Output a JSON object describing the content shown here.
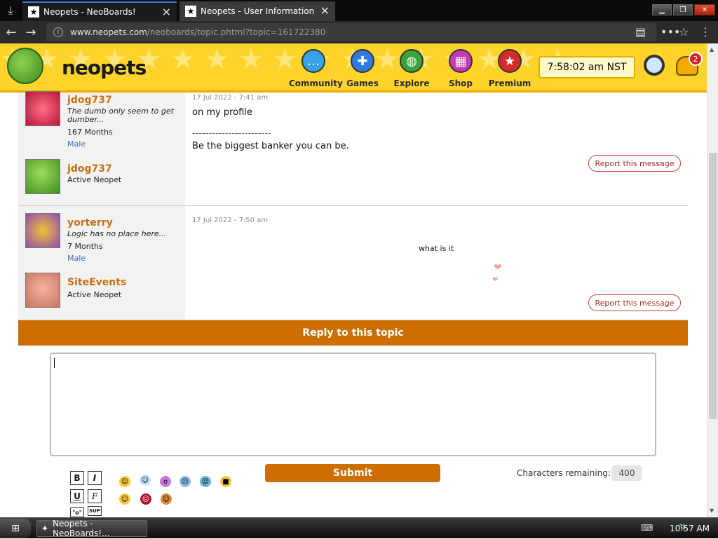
{
  "browser": {
    "tabs": [
      {
        "title": "Neopets - NeoBoards!",
        "active": true
      },
      {
        "title": "Neopets - User Information",
        "active": false
      }
    ],
    "url_host": "www.neopets.com",
    "url_path": "/neoboards/topic.phtml?topic=161722380"
  },
  "header": {
    "logo": "neopets",
    "nav": [
      {
        "label": "Community",
        "icon": "speech-bubble-icon",
        "color": "#3aa0e8"
      },
      {
        "label": "Games",
        "icon": "gamepad-icon",
        "color": "#2f7be0"
      },
      {
        "label": "Explore",
        "icon": "globe-icon",
        "color": "#3aa33a"
      },
      {
        "label": "Shop",
        "icon": "shopping-cart-icon",
        "color": "#c23ab7"
      },
      {
        "label": "Premium",
        "icon": "star-icon",
        "color": "#d62b2b"
      }
    ],
    "clock": "7:58:02 am NST",
    "notifications": "2"
  },
  "posts": [
    {
      "username": "jdog737",
      "signature": "The dumb only seem to get dumber...",
      "account_age": "167 Months",
      "gender": "Male",
      "pet_name": "jdog737",
      "pet_status": "Active Neopet",
      "date": "17 Jul 2022 - 7:41 am",
      "message_lines": [
        "on my profile",
        "------------------------",
        "Be the biggest banker you can be."
      ],
      "report": "Report this message"
    },
    {
      "username": "yorterry",
      "signature": "Logic has no place here...",
      "account_age": "7 Months",
      "gender": "Male",
      "pet_name": "SiteEvents",
      "pet_status": "Active Neopet",
      "date": "17 Jul 2022 - 7:50 am",
      "message_lines": [
        "what is it"
      ],
      "report": "Report this message"
    }
  ],
  "reply": {
    "title": "Reply to this topic",
    "submit": "Submit",
    "chars_label": "Characters remaining:",
    "chars_count": "400",
    "format_buttons": [
      "B",
      "I",
      "U",
      "F",
      "\"o\"",
      "SUP"
    ]
  },
  "taskbar": {
    "task": "Neopets - NeoBoards!...",
    "time": "10:57 AM"
  }
}
